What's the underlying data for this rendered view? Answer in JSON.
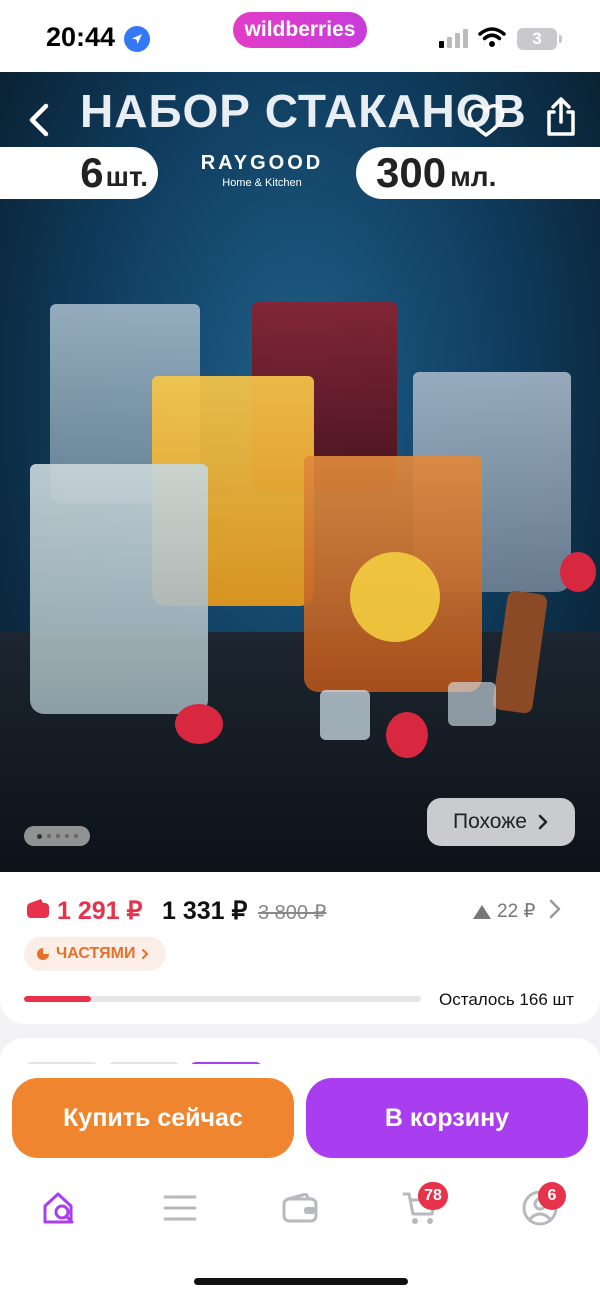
{
  "status_bar": {
    "time": "20:44",
    "battery": "3",
    "app_pill": "wildberries"
  },
  "hero": {
    "title": "НАБОР СТАКАНОВ",
    "count_number": "6",
    "count_unit": "шт.",
    "volume_number": "300",
    "volume_unit": "мл.",
    "brand_name": "RAYGOOD",
    "brand_sub": "Home & Kitchen",
    "similar_label": "Похоже",
    "gallery_total": 5,
    "gallery_current": 1
  },
  "price": {
    "wallet_price": "1 291 ₽",
    "price": "1 331 ₽",
    "old_price": "3 800 ₽",
    "delta": "22 ₽",
    "installment_label": "ЧАСТЯМИ",
    "stock_text": "Осталось 166 шт",
    "stock_fraction": 0.17
  },
  "actions": {
    "buy_now": "Купить сейчас",
    "add_to_cart": "В корзину"
  },
  "nav": {
    "items": [
      "home-search",
      "catalog",
      "wallet",
      "cart",
      "profile"
    ],
    "cart_badge": "78",
    "profile_badge": "6"
  },
  "colors": {
    "accent": "#a83ef0",
    "buy": "#f08530",
    "price_red": "#e8324c"
  }
}
